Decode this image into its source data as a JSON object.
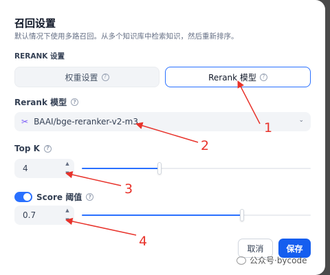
{
  "dialog": {
    "title": "召回设置",
    "subtitle": "默认情况下使用多路召回。从多个知识库中检索知识，然后重新排序。",
    "section_label": "RERANK 设置"
  },
  "tabs": [
    {
      "label": "权重设置",
      "icon": "question-circle-icon",
      "active": false
    },
    {
      "label": "Rerank 模型",
      "icon": "question-circle-icon",
      "active": true
    }
  ],
  "rerank_model": {
    "label": "Rerank 模型",
    "icon": "question-circle-icon",
    "model_icon": "model-logo-icon",
    "value": "BAAI/bge-reranker-v2-m3",
    "dropdown_icon": "chevron-down-icon"
  },
  "top_k": {
    "label": "Top K",
    "icon": "question-circle-icon",
    "value": "4",
    "slider_fraction": 0.34
  },
  "score_threshold": {
    "enabled": true,
    "label": "Score 阈值",
    "icon": "question-circle-icon",
    "value": "0.7",
    "slider_fraction": 0.7
  },
  "buttons": {
    "cancel": "取消",
    "save": "保存"
  },
  "watermark": {
    "text": "公众号·bycode"
  },
  "annotations": {
    "labels": [
      "1",
      "2",
      "3",
      "4"
    ],
    "color": "#e8322a"
  },
  "colors": {
    "accent": "#155eef",
    "tab_active_border": "#2970ff",
    "slider_fill": "#2970ff"
  }
}
